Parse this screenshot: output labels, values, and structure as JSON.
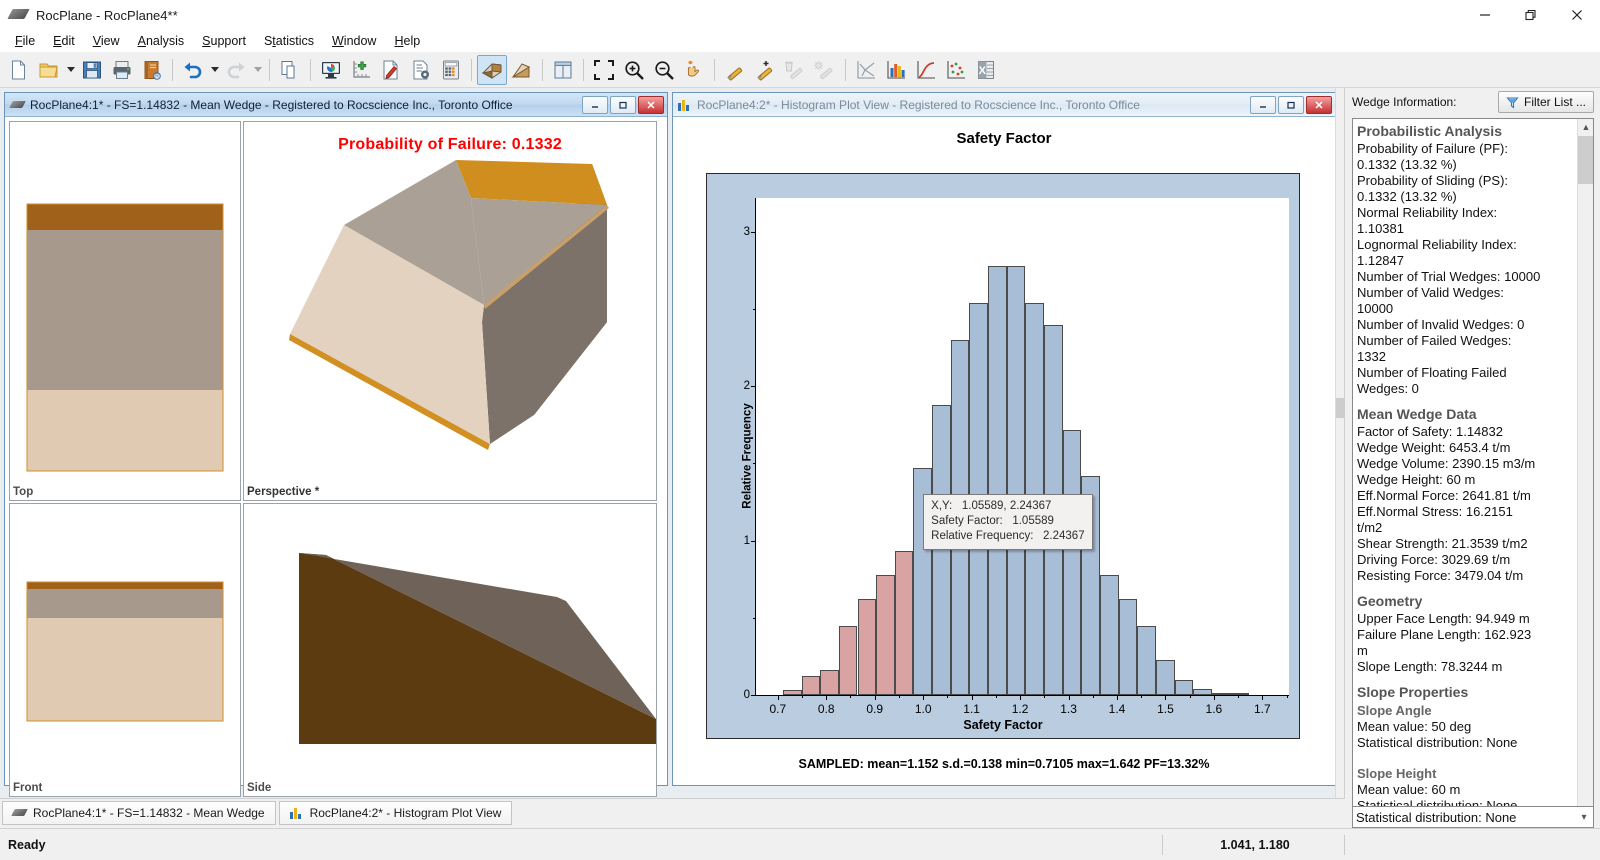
{
  "window": {
    "title": "RocPlane - RocPlane4**",
    "app_icon": "wedge-icon",
    "controls": {
      "minimize": "minimize-icon",
      "restore": "restore-icon",
      "close": "close-icon"
    }
  },
  "menu": [
    {
      "label": "File",
      "accel": "F"
    },
    {
      "label": "Edit",
      "accel": "E"
    },
    {
      "label": "View",
      "accel": "V"
    },
    {
      "label": "Analysis",
      "accel": "A"
    },
    {
      "label": "Support",
      "accel": "S"
    },
    {
      "label": "Statistics",
      "accel": "t"
    },
    {
      "label": "Window",
      "accel": "W"
    },
    {
      "label": "Help",
      "accel": "H"
    }
  ],
  "toolbar": {
    "items": [
      {
        "name": "new-icon",
        "tip": "New",
        "state": "enabled"
      },
      {
        "name": "open-folder-icon",
        "tip": "Open",
        "state": "enabled",
        "dropdown": true
      },
      {
        "name": "save-floppy-icon",
        "tip": "Save",
        "state": "enabled"
      },
      {
        "name": "print-icon",
        "tip": "Print",
        "state": "enabled"
      },
      {
        "name": "report-book-icon",
        "tip": "Report",
        "state": "enabled"
      },
      {
        "name": "separator",
        "tip": "",
        "state": "sep"
      },
      {
        "name": "undo-icon",
        "tip": "Undo",
        "state": "enabled",
        "dropdown": true
      },
      {
        "name": "redo-icon",
        "tip": "Redo",
        "state": "disabled",
        "dropdown": true
      },
      {
        "name": "separator",
        "tip": "",
        "state": "sep"
      },
      {
        "name": "copy-icon",
        "tip": "Copy",
        "state": "enabled"
      },
      {
        "name": "separator",
        "tip": "",
        "state": "sep"
      },
      {
        "name": "display-options-icon",
        "tip": "Display Options",
        "state": "enabled"
      },
      {
        "name": "add-axes-icon",
        "tip": "Add Axes",
        "state": "enabled"
      },
      {
        "name": "edit-properties-icon",
        "tip": "Edit Properties",
        "state": "enabled"
      },
      {
        "name": "project-settings-icon",
        "tip": "Project Settings",
        "state": "enabled"
      },
      {
        "name": "calculator-icon",
        "tip": "Compute",
        "state": "enabled"
      },
      {
        "name": "separator",
        "tip": "",
        "state": "sep"
      },
      {
        "name": "wedge-view-icon",
        "tip": "Wedge View",
        "state": "active"
      },
      {
        "name": "slope-view-icon",
        "tip": "Slope View",
        "state": "enabled"
      },
      {
        "name": "separator",
        "tip": "",
        "state": "sep"
      },
      {
        "name": "tile-windows-icon",
        "tip": "Tile Windows",
        "state": "enabled"
      },
      {
        "name": "separator",
        "tip": "",
        "state": "sep"
      },
      {
        "name": "zoom-all-icon",
        "tip": "Zoom All",
        "state": "enabled"
      },
      {
        "name": "zoom-in-icon",
        "tip": "Zoom In",
        "state": "enabled"
      },
      {
        "name": "zoom-out-icon",
        "tip": "Zoom Out",
        "state": "enabled"
      },
      {
        "name": "pan-icon",
        "tip": "Pan",
        "state": "enabled"
      },
      {
        "name": "separator",
        "tip": "",
        "state": "sep"
      },
      {
        "name": "add-bolt-icon",
        "tip": "Add Bolt",
        "state": "enabled"
      },
      {
        "name": "add-bolt-plus-icon",
        "tip": "Add Bolt Pattern",
        "state": "enabled"
      },
      {
        "name": "delete-bolt-icon",
        "tip": "Delete Bolt",
        "state": "disabled"
      },
      {
        "name": "bolt-properties-icon",
        "tip": "Bolt Properties",
        "state": "disabled"
      },
      {
        "name": "separator",
        "tip": "",
        "state": "sep"
      },
      {
        "name": "scatter-plot-icon",
        "tip": "Scatter Plot",
        "state": "enabled"
      },
      {
        "name": "histogram-plot-icon",
        "tip": "Histogram Plot",
        "state": "enabled"
      },
      {
        "name": "cumulative-plot-icon",
        "tip": "Cumulative Plot",
        "state": "enabled"
      },
      {
        "name": "sample-plot-icon",
        "tip": "Sample Plot",
        "state": "enabled"
      },
      {
        "name": "export-excel-icon",
        "tip": "Export to Excel",
        "state": "enabled"
      }
    ]
  },
  "wedge_window": {
    "title": "RocPlane4:1* - FS=1.14832 - Mean Wedge - Registered to Rocscience Inc., Toronto Office",
    "icon": "wedge-icon",
    "active": true,
    "probability_of_failure_label": "Probability of Failure: 0.1332",
    "panes": [
      {
        "label": "Top"
      },
      {
        "label": "Perspective *"
      },
      {
        "label": "Front"
      },
      {
        "label": "Side"
      }
    ]
  },
  "hist_window": {
    "title": "RocPlane4:2* - Histogram Plot View - Registered to Rocscience Inc., Toronto Office",
    "icon": "histogram-icon",
    "active": false,
    "plot_title": "Safety Factor",
    "summary": "SAMPLED: mean=1.152 s.d.=0.138 min=0.7105 max=1.642 PF=13.32%",
    "tooltip": {
      "xy_label": "X,Y:",
      "xy_value": "1.05589, 2.24367",
      "sf_label": "Safety Factor:",
      "sf_value": "1.05589",
      "rf_label": "Relative Frequency:",
      "rf_value": "2.24367"
    }
  },
  "chart_data": {
    "type": "bar",
    "title": "Safety Factor",
    "xlabel": "Safety Factor",
    "ylabel": "Relative Frequency",
    "xlim": [
      0.655,
      1.755
    ],
    "ylim": [
      0,
      3.22
    ],
    "xticks": [
      0.7,
      0.8,
      0.9,
      1.0,
      1.1,
      1.2,
      1.3,
      1.4,
      1.5,
      1.6,
      1.7
    ],
    "yticks": [
      0,
      1,
      2,
      3
    ],
    "yticks_minor": [
      0.5,
      1.5,
      2.5
    ],
    "bin_width": 0.0385,
    "bin_starts": [
      0.7105,
      0.749,
      0.7875,
      0.826,
      0.8645,
      0.903,
      0.9415,
      0.98,
      1.0185,
      1.057,
      1.0955,
      1.134,
      1.1725,
      1.211,
      1.2495,
      1.288,
      1.3265,
      1.365,
      1.4035,
      1.442,
      1.4805,
      1.519,
      1.5575,
      1.596,
      1.6345
    ],
    "values": [
      0.03,
      0.12,
      0.16,
      0.45,
      0.62,
      0.78,
      0.93,
      1.47,
      1.88,
      2.3,
      2.54,
      2.78,
      2.78,
      2.54,
      2.4,
      1.72,
      1.42,
      0.78,
      0.62,
      0.45,
      0.23,
      0.1,
      0.04,
      0.01,
      0.01
    ],
    "colors": {
      "failed": "#d9a3a3",
      "safe": "#a8bdd6",
      "bar_border": "#4b4b4b",
      "plot_bg": "#b9cce0"
    },
    "failed_threshold": 1.0,
    "legend": "none",
    "grid": false,
    "annotations": [
      {
        "text": "SAMPLED: mean=1.152 s.d.=0.138 min=0.7105 max=1.642 PF=13.32%",
        "position": "below-axes"
      }
    ],
    "stats": {
      "mean": 1.152,
      "sd": 0.138,
      "min": 0.7105,
      "max": 1.642,
      "pf_percent": 13.32
    }
  },
  "sidebar": {
    "header_label": "Wedge Information:",
    "filter_button": "Filter List ...",
    "filter_icon": "funnel-icon",
    "sections": [
      {
        "heading": "Probabilistic Analysis",
        "lines": [
          "Probability of Failure (PF):",
          "0.1332 (13.32 %)",
          "Probability of Sliding (PS):",
          "0.1332 (13.32 %)",
          "Normal Reliability Index:",
          "1.10381",
          "Lognormal Reliability Index:",
          "1.12847",
          "Number of Trial Wedges: 10000",
          "Number of Valid Wedges:",
          "10000",
          "Number of Invalid Wedges: 0",
          "Number of Failed Wedges:",
          "1332",
          "Number of Floating Failed",
          "Wedges: 0"
        ]
      },
      {
        "heading": "Mean Wedge Data",
        "lines": [
          "Factor of Safety: 1.14832",
          "Wedge Weight: 6453.4 t/m",
          "Wedge Volume: 2390.15 m3/m",
          "Wedge Height: 60 m",
          "Eff.Normal Force: 2641.81 t/m",
          "Eff.Normal Stress: 16.2151",
          "t/m2",
          "Shear Strength: 21.3539 t/m2",
          "Driving Force: 3029.69 t/m",
          "Resisting Force: 3479.04 t/m"
        ]
      },
      {
        "heading": "Geometry",
        "lines": [
          "Upper Face Length: 94.949 m",
          "Failure Plane Length: 162.923",
          "m",
          "Slope Length: 78.3244 m"
        ]
      },
      {
        "heading": "Slope Properties",
        "subsections": [
          {
            "sub": "Slope Angle",
            "lines": [
              "Mean value: 50 deg",
              "Statistical distribution: None"
            ]
          },
          {
            "sub": "Slope Height",
            "lines": [
              "Mean value: 60 m",
              "Statistical distribution: None"
            ]
          }
        ]
      }
    ],
    "combo_value": "Statistical distribution: None"
  },
  "tabs": [
    {
      "label": "RocPlane4:1* - FS=1.14832 - Mean Wedge",
      "icon": "wedge-icon"
    },
    {
      "label": "RocPlane4:2* - Histogram Plot View",
      "icon": "histogram-icon"
    }
  ],
  "statusbar": {
    "message": "Ready",
    "coordinates": "1.041, 1.180"
  }
}
